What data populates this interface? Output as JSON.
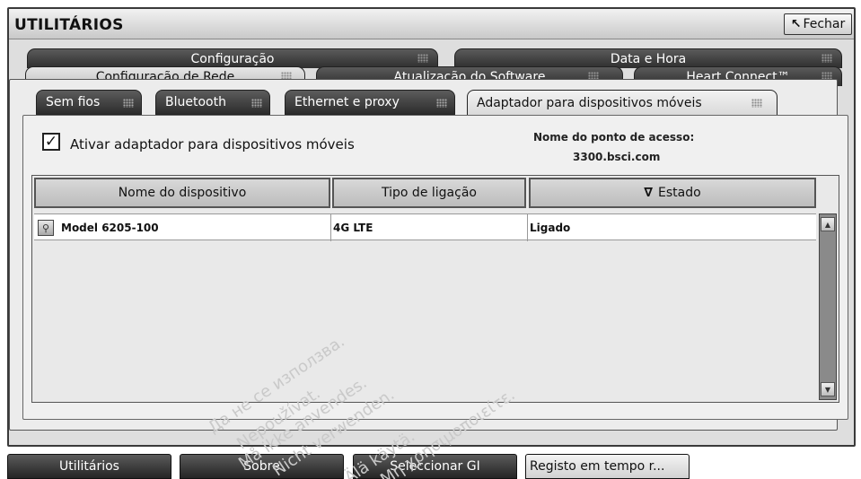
{
  "window": {
    "title": "UTILITÁRIOS",
    "close_label": "Fechar",
    "close_icon": "arrow-up-left-icon"
  },
  "tabs_row1": [
    {
      "label": "Configuração"
    },
    {
      "label": "Data e Hora"
    }
  ],
  "tabs_row2": [
    {
      "label": "Configuração de Rede",
      "active": true
    },
    {
      "label": "Atualização do Software"
    },
    {
      "label": "Heart Connect™"
    }
  ],
  "subtabs": [
    {
      "label": "Sem fios"
    },
    {
      "label": "Bluetooth"
    },
    {
      "label": "Ethernet e proxy"
    },
    {
      "label": "Adaptador para dispositivos móveis",
      "active": true
    }
  ],
  "adapter": {
    "enable_label": "Ativar adaptador para dispositivos móveis",
    "enabled": true,
    "access_point_label": "Nome do ponto de acesso:",
    "access_point_value": "3300.bsci.com"
  },
  "table": {
    "columns": [
      "Nome do dispositivo",
      "Tipo de ligação",
      "Estado"
    ],
    "sort_indicator": "∇",
    "rows": [
      {
        "device": "Model 6205-100",
        "connection": "4G LTE",
        "status": "Ligado"
      }
    ]
  },
  "bottom_buttons": [
    {
      "label": "Utilitários"
    },
    {
      "label": "Sobre"
    },
    {
      "label": "Seleccionar GI"
    },
    {
      "label": "Registo em tempo r..."
    }
  ],
  "watermark": [
    "Да не се използва.",
    "Nepoužívat.",
    "Må ikke anvendes.",
    "Nicht verwenden.",
    "Älä käytä.",
    "Μη χρησιμοποιείτε."
  ]
}
